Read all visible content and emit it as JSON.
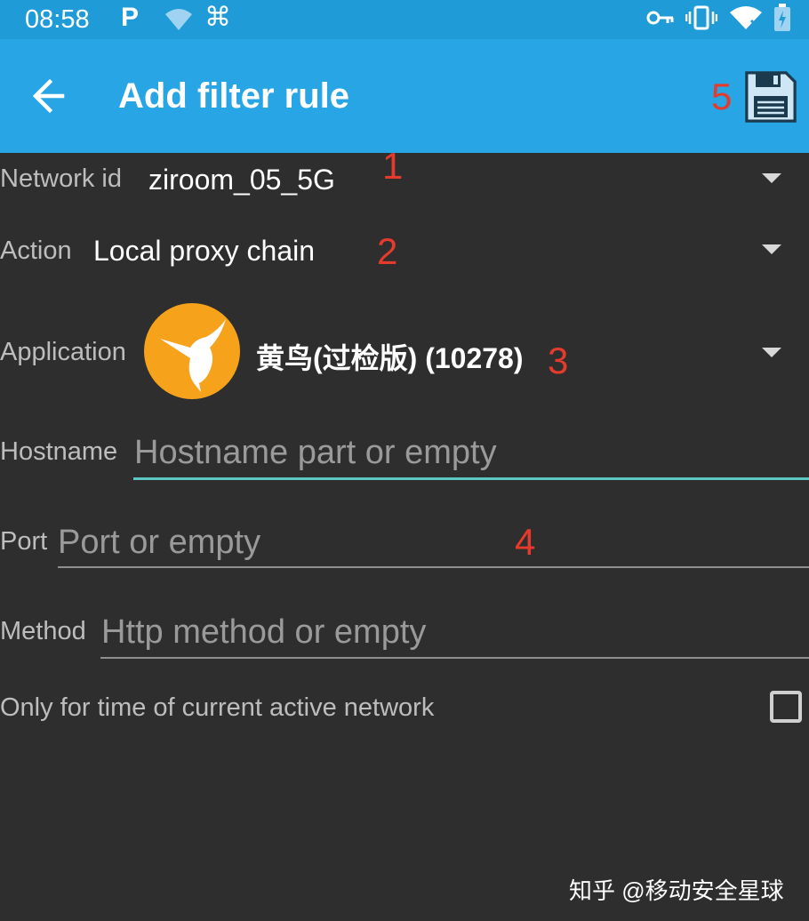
{
  "status_bar": {
    "time": "08:58",
    "icons": [
      "parking-p-icon",
      "wifi-question-icon",
      "command-icon",
      "key-icon",
      "vibrate-icon",
      "wifi-off-icon",
      "battery-icon"
    ]
  },
  "app_bar": {
    "title": "Add filter rule",
    "back_icon": "arrow-left-icon",
    "save_icon": "floppy-disk-icon",
    "color": "#27a5e4"
  },
  "form": {
    "network_id": {
      "label": "Network id",
      "value": "ziroom_05_5G"
    },
    "action": {
      "label": "Action",
      "value": "Local proxy chain"
    },
    "application": {
      "label": "Application",
      "value": "黄鸟(过检版) (10278)",
      "icon": "hummingbird-icon"
    },
    "hostname": {
      "label": "Hostname",
      "placeholder": "Hostname part or empty"
    },
    "port": {
      "label": "Port",
      "placeholder": "Port or empty"
    },
    "method": {
      "label": "Method",
      "placeholder": "Http method or empty"
    },
    "active_network": {
      "label": "Only for time of current active network",
      "checked": false
    }
  },
  "annotations": [
    "1",
    "2",
    "3",
    "4",
    "5"
  ],
  "annotation_color": "#e53b2c",
  "watermark": "知乎 @移动安全星球"
}
